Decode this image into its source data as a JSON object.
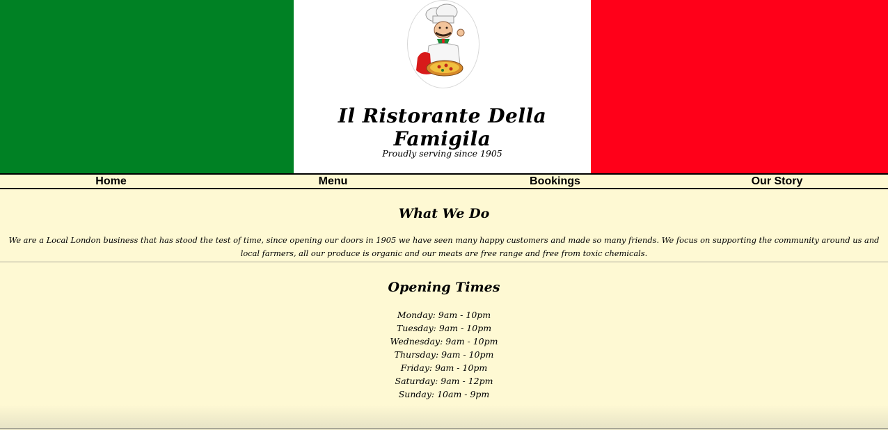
{
  "colors": {
    "green": "#008124",
    "white": "#ffffff",
    "red": "#ff0019",
    "background": "#fef9d3"
  },
  "header": {
    "logo_icon": "chef-with-pizza-logo",
    "title": "Il Ristorante Della Famigila",
    "tagline": "Proudly serving since 1905"
  },
  "nav": {
    "items": [
      {
        "label": "Home"
      },
      {
        "label": "Menu"
      },
      {
        "label": "Bookings"
      },
      {
        "label": "Our Story"
      }
    ]
  },
  "what_we_do": {
    "heading": "What We Do",
    "body": "We are a Local London business that has stood the test of time, since opening our doors in 1905 we have seen many happy customers and made so many friends. We focus on supporting the community around us and local farmers, all our produce is organic and our meats are free range and free from toxic chemicals."
  },
  "opening_times": {
    "heading": "Opening Times",
    "days": [
      "Monday: 9am - 10pm",
      "Tuesday: 9am - 10pm",
      "Wednesday: 9am - 10pm",
      "Thursday: 9am - 10pm",
      "Friday: 9am - 10pm",
      "Saturday: 9am - 12pm",
      "Sunday: 10am - 9pm"
    ]
  }
}
